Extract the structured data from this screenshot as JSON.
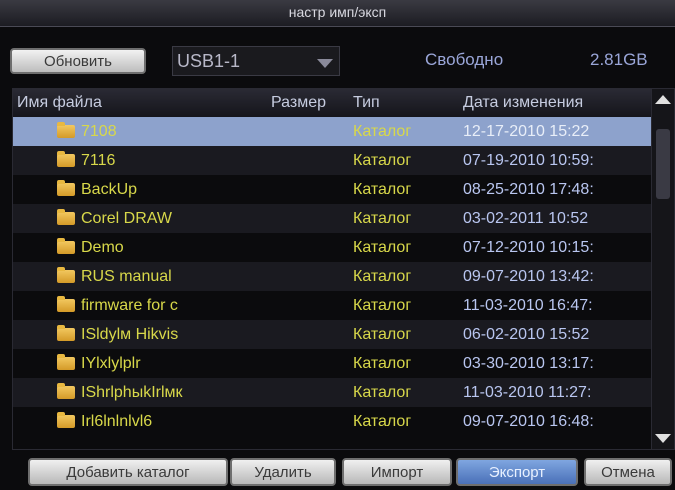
{
  "window": {
    "title": "настр имп/эксп"
  },
  "toolbar": {
    "refresh_label": "Обновить",
    "device_value": "USB1-1",
    "free_label": "Свободно",
    "free_value": "2.81GB"
  },
  "table": {
    "columns": [
      "Имя файла",
      "Размер",
      "Тип",
      "Дата изменения"
    ],
    "rows": [
      {
        "name": "7108",
        "size": "",
        "type": "Каталог",
        "date": "12-17-2010 15:22",
        "selected": true
      },
      {
        "name": "7116",
        "size": "",
        "type": "Каталог",
        "date": "07-19-2010 10:59:"
      },
      {
        "name": "BackUp",
        "size": "",
        "type": "Каталог",
        "date": "08-25-2010 17:48:"
      },
      {
        "name": "Corel DRAW",
        "size": "",
        "type": "Каталог",
        "date": "03-02-2011 10:52"
      },
      {
        "name": "Demo",
        "size": "",
        "type": "Каталог",
        "date": "07-12-2010 10:15:"
      },
      {
        "name": "RUS manual",
        "size": "",
        "type": "Каталог",
        "date": "09-07-2010 13:42:"
      },
      {
        "name": "firmware for c",
        "size": "",
        "type": "Каталог",
        "date": "11-03-2010 16:47:"
      },
      {
        "name": "ISldylм Hikvis",
        "size": "",
        "type": "Каталог",
        "date": "06-02-2010 15:52"
      },
      {
        "name": "IYlxlylplr",
        "size": "",
        "type": "Каталог",
        "date": "03-30-2010 13:17:"
      },
      {
        "name": "IShrlphыkIrlмк",
        "size": "",
        "type": "Каталог",
        "date": "11-03-2010 11:27:"
      },
      {
        "name": "Irl6lnlnlvl6",
        "size": "",
        "type": "Каталог",
        "date": "09-07-2010 16:48:"
      }
    ]
  },
  "footer": {
    "add_dir_label": "Добавить каталог",
    "delete_label": "Удалить",
    "import_label": "Импорт",
    "export_label": "Экспорт",
    "cancel_label": "Отмена"
  },
  "colors": {
    "selected_row": "#8da2cc",
    "name_text": "#d8d84a",
    "date_text": "#b9c6f0"
  }
}
